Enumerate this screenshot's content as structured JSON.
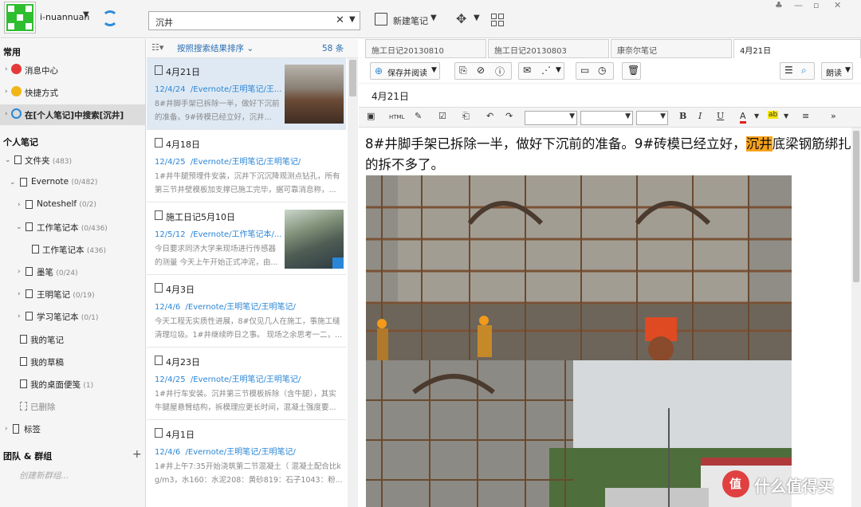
{
  "user": {
    "name": "i-nuannuan"
  },
  "search": {
    "value": "沉井"
  },
  "toolbar": {
    "new_note": "新建笔记"
  },
  "window_controls": [
    "♣",
    "—",
    "▫",
    "✕"
  ],
  "sidebar": {
    "common_header": "常用",
    "common_items": [
      "消息中心",
      "快捷方式",
      "在[个人笔记]中搜索[沉井]"
    ],
    "personal_header": "个人笔记",
    "tree": [
      {
        "label": "文件夹",
        "count": "(483)"
      },
      {
        "label": "Evernote",
        "count": "(0/482)"
      },
      {
        "label": "Noteshelf",
        "count": "(0/2)"
      },
      {
        "label": "工作笔记本",
        "count": "(0/436)"
      },
      {
        "label": "工作笔记本",
        "count": "(436)"
      },
      {
        "label": "墨笔",
        "count": "(0/24)"
      },
      {
        "label": "王明笔记",
        "count": "(0/19)"
      },
      {
        "label": "学习笔记本",
        "count": "(0/1)"
      },
      {
        "label": "我的笔记",
        "count": ""
      },
      {
        "label": "我的草稿",
        "count": ""
      },
      {
        "label": "我的桌面便笺",
        "count": "(1)"
      },
      {
        "label": "已删除",
        "count": ""
      },
      {
        "label": "标签",
        "count": ""
      }
    ],
    "team_header": "团队 & 群组",
    "team_add": "+",
    "team_placeholder": "创建新群组..."
  },
  "list": {
    "sort_label": "按照搜索结果排序",
    "count": "58 条",
    "notes": [
      {
        "title": "4月21日",
        "date": "12/4/24",
        "path": "/Evernote/王明笔记/王...",
        "snippet": "8#井脚手架已拆除一半，做好下沉前的准备。9#砖模已经立好，沉井..."
      },
      {
        "title": "4月18日",
        "date": "12/4/25",
        "path": "/Evernote/王明笔记/王明笔记/",
        "snippet": "1#井牛腿预埋件安装，沉井下沉沉降观测点钻孔，所有第三节井壁模板加支撑已施工完毕，据可靠消息称，..."
      },
      {
        "title": "施工日记5月10日",
        "date": "12/5/12",
        "path": "/Evernote/工作笔记本/...",
        "snippet": "今日要求同济大学来现场进行传感器的测量 今天上午开始正式冲泥，由..."
      },
      {
        "title": "4月3日",
        "date": "12/4/6",
        "path": "/Evernote/王明笔记/王明笔记/",
        "snippet": "今天工程无实质性进展，8#仅见几人在施工，事施工缝清理垃圾。1#井继续昨日之事。 现场之余思考一二，..."
      },
      {
        "title": "4月23日",
        "date": "12/4/25",
        "path": "/Evernote/王明笔记/王明笔记/",
        "snippet": "1#井行车安装。沉井第三节模板拆除（含牛腿），其实牛腿屋悬臂结构，拆模理应更长时间，混凝土强度要..."
      },
      {
        "title": "4月1日",
        "date": "12/4/6",
        "path": "/Evernote/王明笔记/王明笔记/",
        "snippet": "1#井上午7:35开始浇筑第二节混凝土（ 混凝土配合比kg/m3，水160：水泥208：黄砂819：石子1043：粉..."
      }
    ]
  },
  "editor": {
    "tabs": [
      "施工日记20130810",
      "施工日记20130803",
      "康奈尔笔记",
      "4月21日"
    ],
    "save_read": "保存并阅读",
    "read_aloud": "朗读",
    "note_title": "4月21日",
    "body_before": "8#井脚手架已拆除一半，做好下沉前的准备。9#砖模已经立好，",
    "body_highlight": "沉井",
    "body_after": "底梁钢筋绑扎的拆不多了。",
    "format_bold": "B",
    "format_italic": "I",
    "format_underline": "U",
    "format_color": "A",
    "format_highlight": "ab",
    "format_html": "HTML",
    "format_more": "»"
  },
  "watermark": {
    "text": "什么值得买",
    "badge": "值"
  }
}
